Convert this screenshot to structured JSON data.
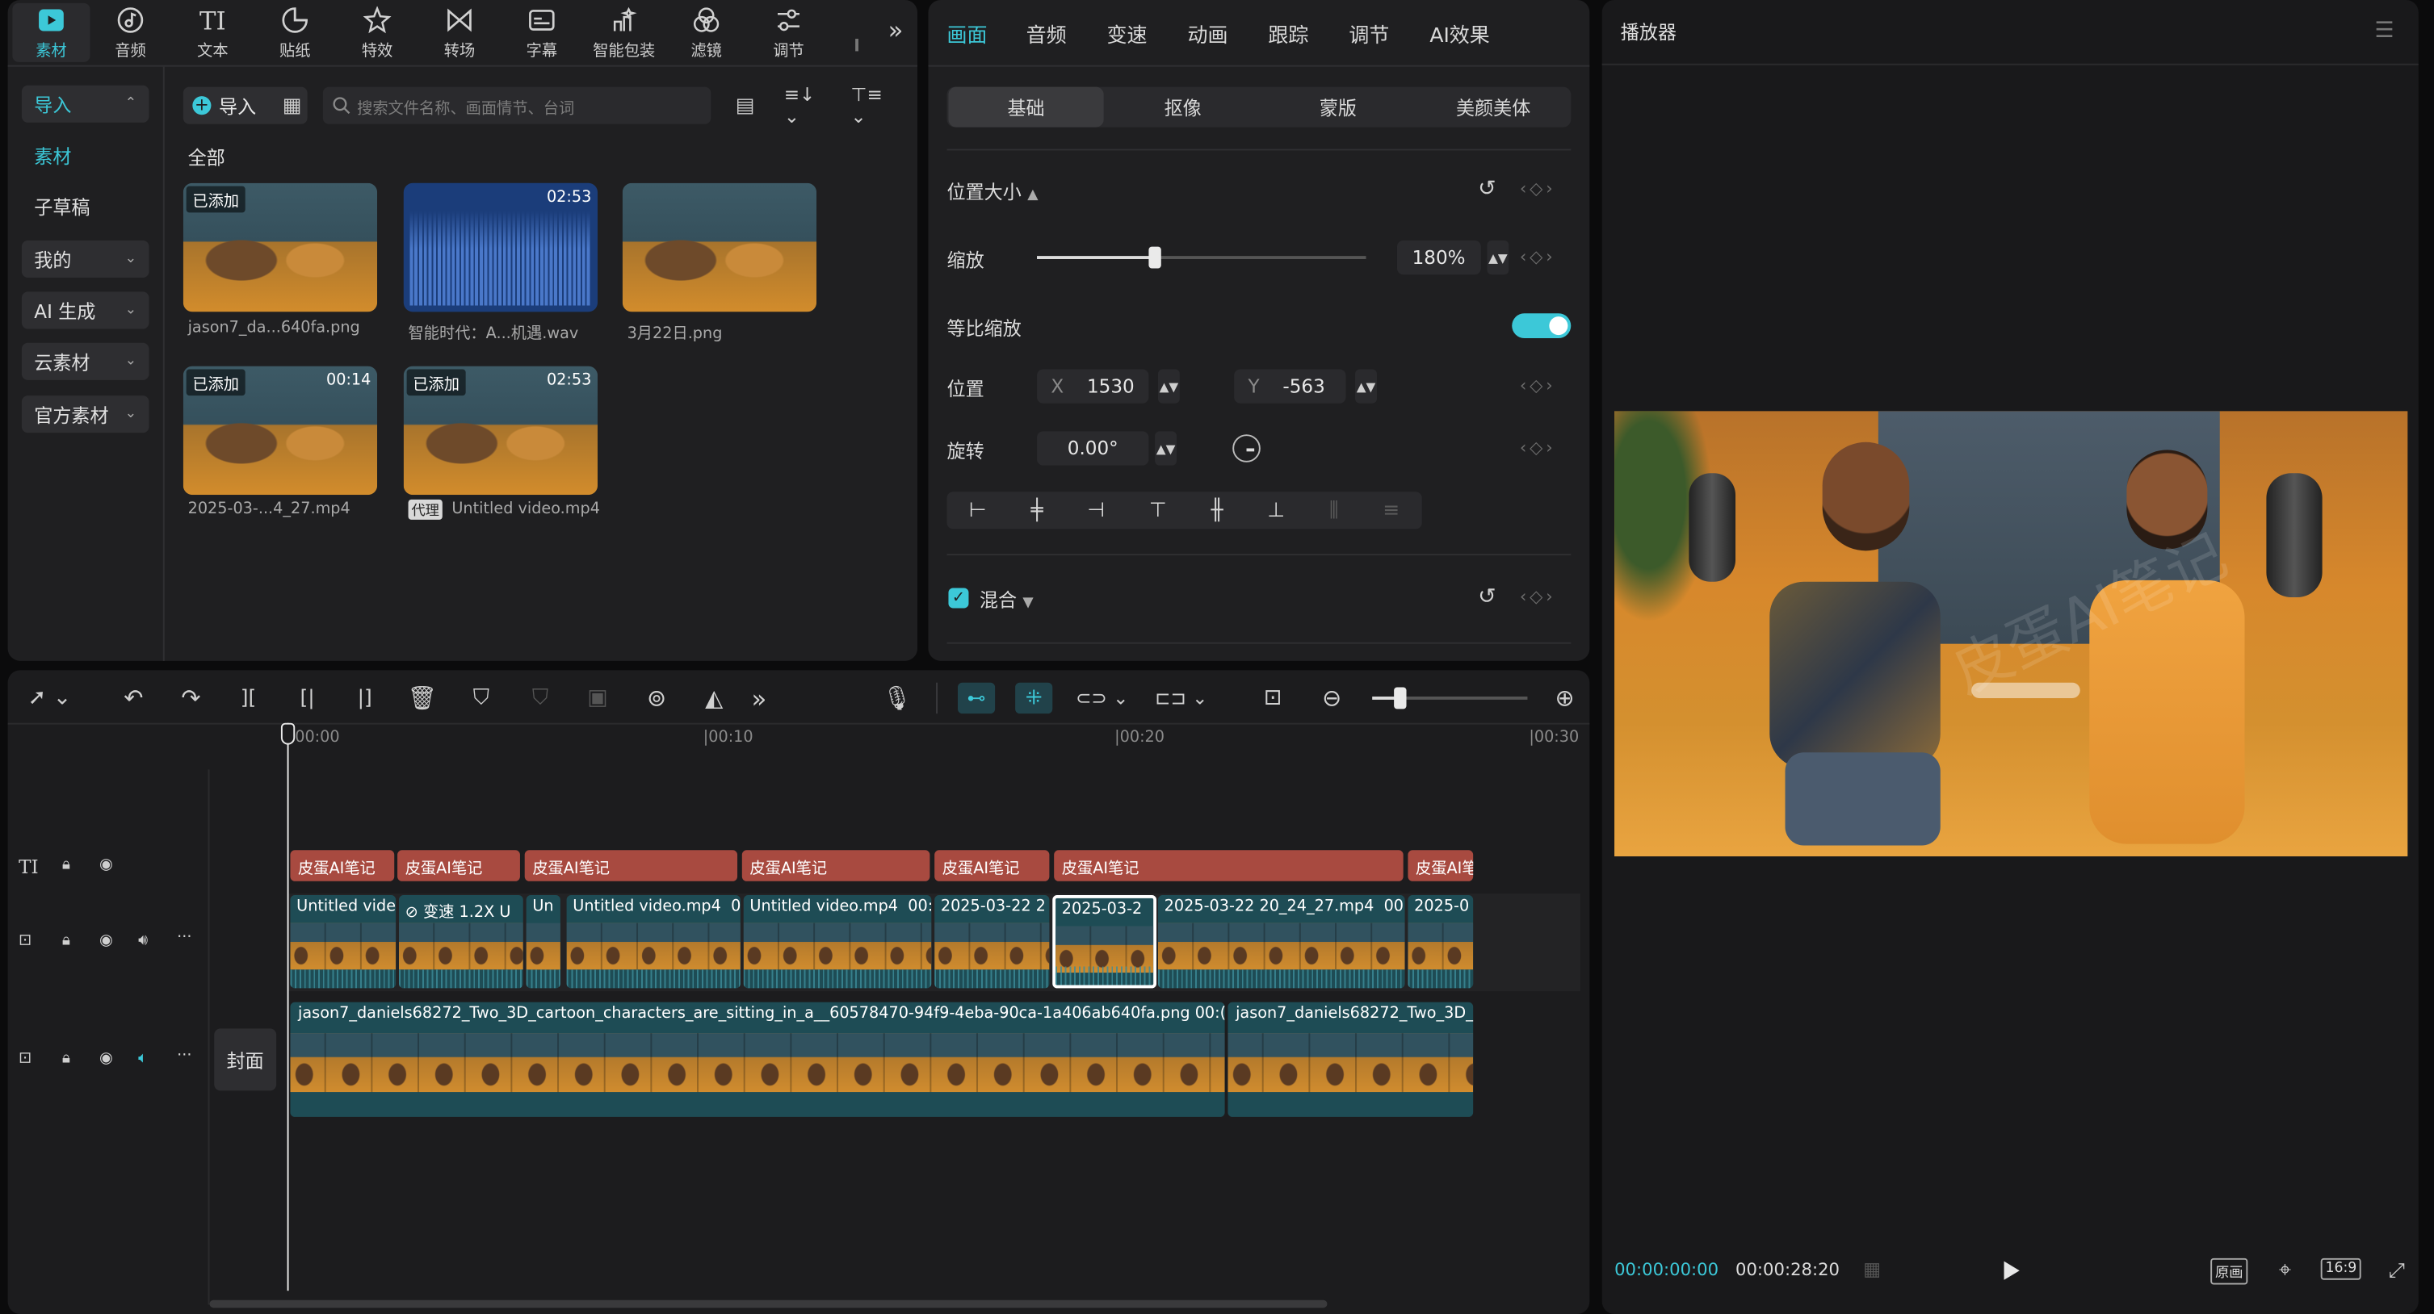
{
  "media_toolbar": {
    "tabs": [
      {
        "label": "素材",
        "icon": "media-icon",
        "active": true
      },
      {
        "label": "音频",
        "icon": "audio-icon"
      },
      {
        "label": "文本",
        "icon": "text-icon"
      },
      {
        "label": "贴纸",
        "icon": "sticker-icon"
      },
      {
        "label": "特效",
        "icon": "effects-icon"
      },
      {
        "label": "转场",
        "icon": "transition-icon"
      },
      {
        "label": "字幕",
        "icon": "subtitle-icon"
      },
      {
        "label": "智能包装",
        "icon": "smart-pack-icon"
      },
      {
        "label": "滤镜",
        "icon": "filter-icon"
      },
      {
        "label": "调节",
        "icon": "adjust-icon"
      }
    ],
    "more_icon": "chevron-double-right-icon"
  },
  "media_sidebar": {
    "items": [
      {
        "label": "导入",
        "chevron": "⌃",
        "active": true
      },
      {
        "label": "素材",
        "active": true
      },
      {
        "label": "子草稿"
      },
      {
        "label": "我的",
        "chevron": "⌄"
      },
      {
        "label": "AI 生成",
        "chevron": "⌄"
      },
      {
        "label": "云素材",
        "chevron": "⌄"
      },
      {
        "label": "官方素材",
        "chevron": "⌄"
      }
    ]
  },
  "media_panel": {
    "import_label": "导入",
    "search_placeholder": "搜索文件名称、画面情节、台词",
    "section_label": "全部",
    "items": [
      {
        "caption": "jason7_da...640fa.png",
        "badge": "已添加",
        "duration": "",
        "type": "image"
      },
      {
        "caption": "智能时代：A...机遇.wav",
        "badge": "",
        "duration": "02:53",
        "type": "audio"
      },
      {
        "caption": "3月22日.png",
        "badge": "",
        "duration": "",
        "type": "image"
      },
      {
        "caption": "2025-03-...4_27.mp4",
        "badge": "已添加",
        "duration": "00:14",
        "type": "video"
      },
      {
        "caption": "Untitled video.mp4",
        "badge": "已添加",
        "duration": "02:53",
        "type": "video",
        "tag": "代理"
      }
    ]
  },
  "inspector": {
    "tabs": [
      "画面",
      "音频",
      "变速",
      "动画",
      "跟踪",
      "调节",
      "AI效果"
    ],
    "active_tab": "画面",
    "segments": [
      "基础",
      "抠像",
      "蒙版",
      "美颜美体"
    ],
    "active_segment": "基础",
    "section_pos_size": "位置大小",
    "scale_label": "缩放",
    "scale_value": "180%",
    "scale_fraction": 0.36,
    "uniform_scale_label": "等比缩放",
    "uniform_scale_on": true,
    "position_label": "位置",
    "x_label": "X",
    "x_value": "1530",
    "y_label": "Y",
    "y_value": "-563",
    "rotation_label": "旋转",
    "rotation_value": "0.00°",
    "blend_label": "混合",
    "blend_checked": true
  },
  "timeline": {
    "ruler_labels": [
      "00:00",
      "|00:10",
      "|00:20",
      "|00:30"
    ],
    "text_clips": [
      "皮蛋AI笔记",
      "皮蛋AI笔记",
      "皮蛋AI笔记",
      "皮蛋AI笔记",
      "皮蛋AI笔记",
      "皮蛋AI笔记",
      "皮蛋AI笔"
    ],
    "video_clips": [
      "Untitled vide",
      "变速 1.2X",
      "U",
      "Un",
      "Untitled video.mp4",
      "0",
      "Untitled video.mp4",
      "00:1",
      "2025-03-22 2",
      "2025-03-2",
      "2025-03-22 20_24_27.mp4",
      "00",
      "2025-0"
    ],
    "main_track": {
      "clip1": "jason7_daniels68272_Two_3D_cartoon_characters_are_sitting_in_a__60578470-94f9-4eba-90ca-1a406ab640fa.png",
      "clip1_suffix": "00:(",
      "clip2": "jason7_daniels68272_Two_3D_c"
    },
    "cover_label": "封面"
  },
  "player": {
    "title": "播放器",
    "current_time": "00:00:00:00",
    "total_time": "00:00:28:20",
    "original_label": "原画",
    "ratio_label": "16:9",
    "watermark_text": "皮蛋AI笔记"
  },
  "colors": {
    "accent": "#3cc8d8",
    "text_clip": "#a84a40",
    "video_clip": "#1e4c55",
    "panel": "#1f1f21"
  }
}
